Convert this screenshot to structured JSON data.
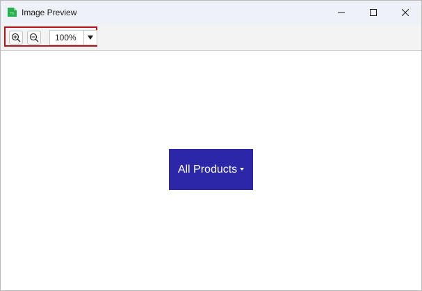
{
  "window": {
    "title": "Image Preview",
    "app_icon": "green-file-icon",
    "controls": [
      "minimize-icon",
      "maximize-icon",
      "close-icon"
    ]
  },
  "toolbar": {
    "zoom_in_icon": "zoom-in-icon",
    "zoom_out_icon": "zoom-out-icon",
    "zoom_level": "100%",
    "highlight_color": "#b3131b"
  },
  "preview": {
    "label": "All Products",
    "background_color": "#2b27a8",
    "text_color": "#ffffff"
  }
}
